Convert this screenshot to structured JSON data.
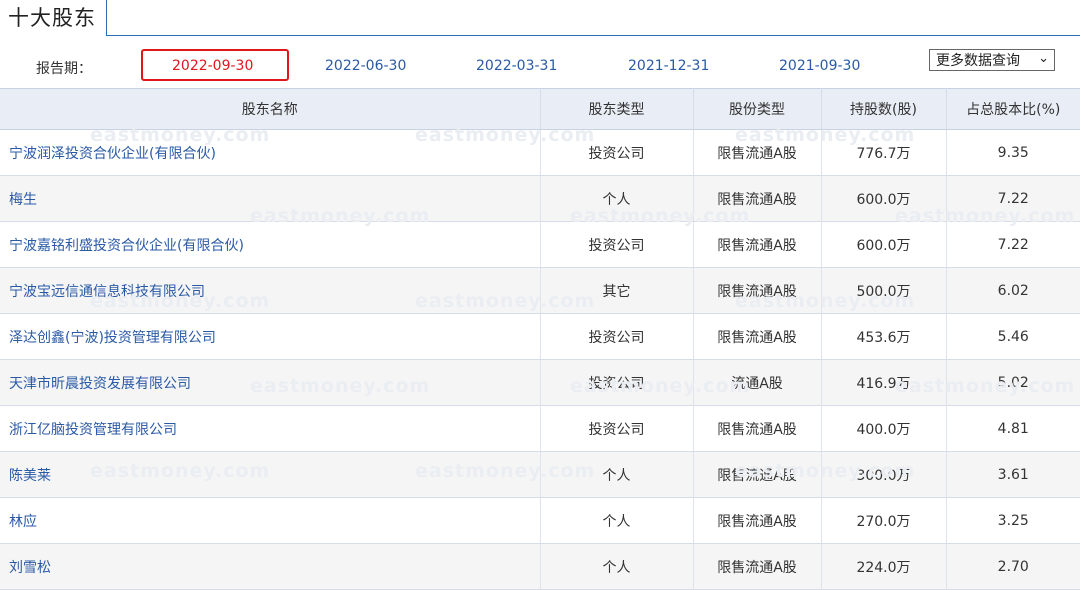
{
  "title": "十大股东",
  "period": {
    "label": "报告期：",
    "dates": [
      "2022-09-30",
      "2022-06-30",
      "2022-03-31",
      "2021-12-31",
      "2021-09-30"
    ],
    "selected_index": 0,
    "more_label": "更多数据查询",
    "selected_color": "#e0161b",
    "link_color": "#2a5aa6"
  },
  "table": {
    "headers": [
      "股东名称",
      "股东类型",
      "股份类型",
      "持股数(股)",
      "占总股本比(%)"
    ],
    "rows": [
      {
        "name": "宁波润泽投资合伙企业(有限合伙)",
        "holder_type": "投资公司",
        "share_type": "限售流通A股",
        "shares": "776.7万",
        "ratio": "9.35"
      },
      {
        "name": "梅生",
        "holder_type": "个人",
        "share_type": "限售流通A股",
        "shares": "600.0万",
        "ratio": "7.22"
      },
      {
        "name": "宁波嘉铭利盛投资合伙企业(有限合伙)",
        "holder_type": "投资公司",
        "share_type": "限售流通A股",
        "shares": "600.0万",
        "ratio": "7.22"
      },
      {
        "name": "宁波宝远信通信息科技有限公司",
        "holder_type": "其它",
        "share_type": "限售流通A股",
        "shares": "500.0万",
        "ratio": "6.02"
      },
      {
        "name": "泽达创鑫(宁波)投资管理有限公司",
        "holder_type": "投资公司",
        "share_type": "限售流通A股",
        "shares": "453.6万",
        "ratio": "5.46"
      },
      {
        "name": "天津市昕晨投资发展有限公司",
        "holder_type": "投资公司",
        "share_type": "流通A股",
        "shares": "416.9万",
        "ratio": "5.02"
      },
      {
        "name": "浙江亿脑投资管理有限公司",
        "holder_type": "投资公司",
        "share_type": "限售流通A股",
        "shares": "400.0万",
        "ratio": "4.81"
      },
      {
        "name": "陈美莱",
        "holder_type": "个人",
        "share_type": "限售流通A股",
        "shares": "300.0万",
        "ratio": "3.61"
      },
      {
        "name": "林应",
        "holder_type": "个人",
        "share_type": "限售流通A股",
        "shares": "270.0万",
        "ratio": "3.25"
      },
      {
        "name": "刘雪松",
        "holder_type": "个人",
        "share_type": "限售流通A股",
        "shares": "224.0万",
        "ratio": "2.70"
      }
    ]
  },
  "watermark_text": "eastmoney.com"
}
